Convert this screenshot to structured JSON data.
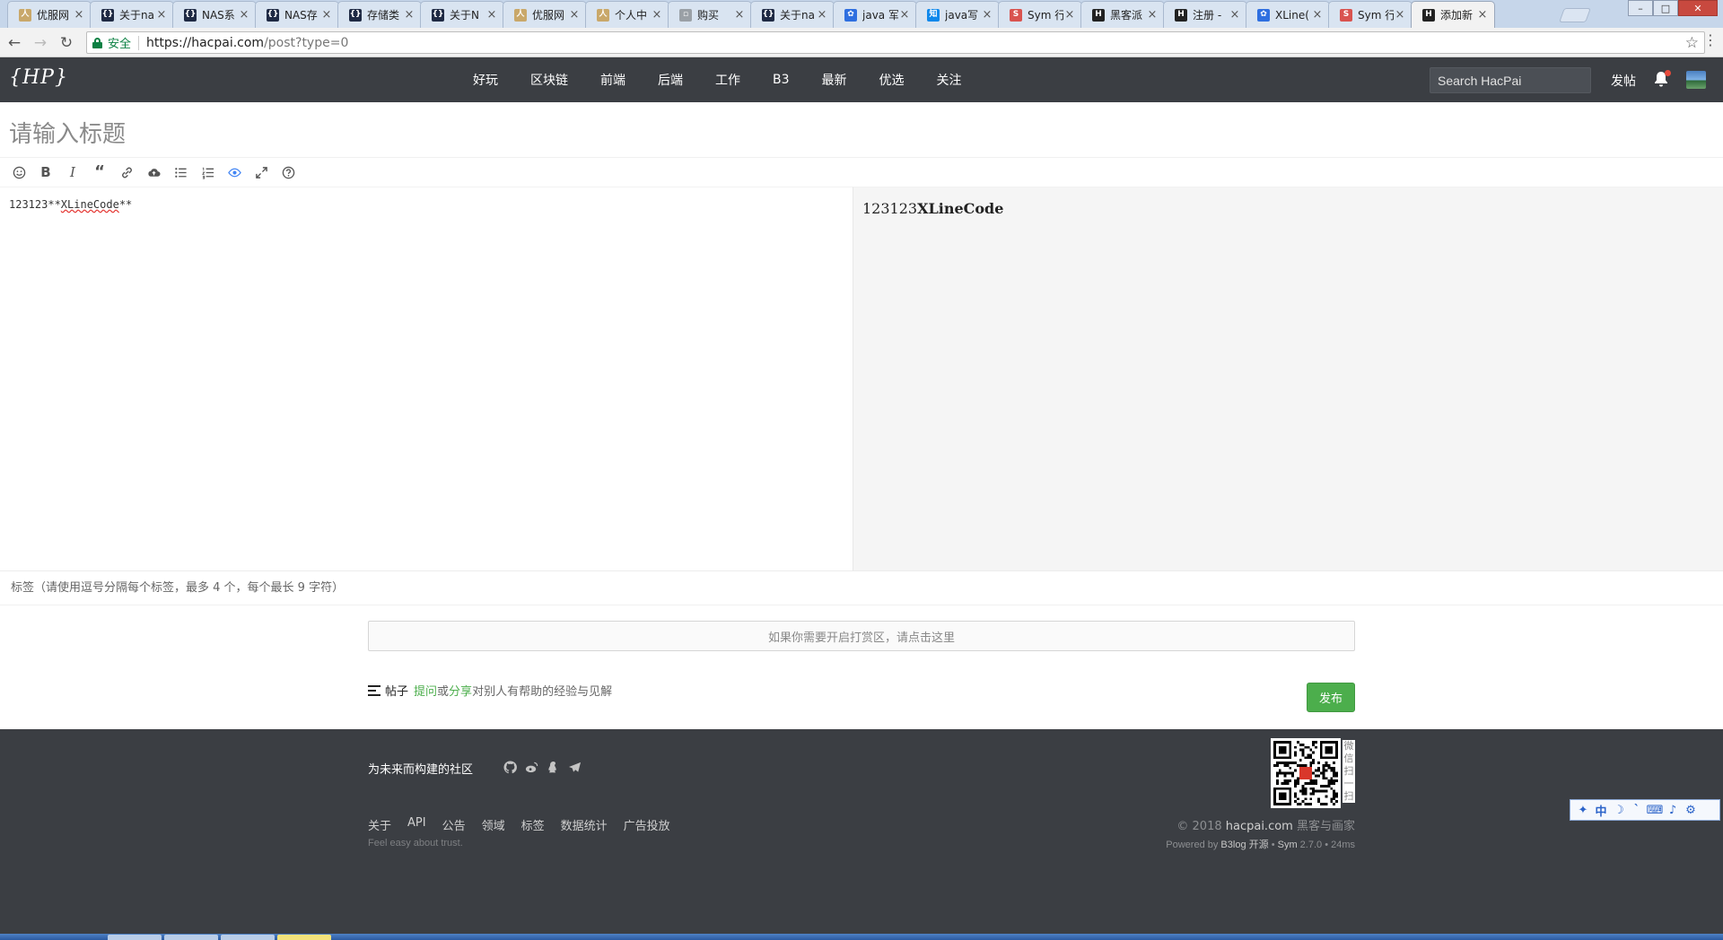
{
  "browser": {
    "tabs": [
      {
        "title": "优服网",
        "fav": "user",
        "color": "#c9a86a",
        "mark": "人",
        "active": false
      },
      {
        "title": "关于na",
        "fav": "code",
        "color": "#1f2a44",
        "mark": "{}",
        "active": false
      },
      {
        "title": "NAS系",
        "fav": "code",
        "color": "#1f2a44",
        "mark": "{}",
        "active": false
      },
      {
        "title": "NAS存",
        "fav": "code",
        "color": "#1f2a44",
        "mark": "{}",
        "active": false
      },
      {
        "title": "存储类",
        "fav": "code",
        "color": "#1f2a44",
        "mark": "{}",
        "active": false
      },
      {
        "title": "关于N",
        "fav": "code",
        "color": "#1f2a44",
        "mark": "{}",
        "active": false
      },
      {
        "title": "优服网",
        "fav": "user",
        "color": "#c9a86a",
        "mark": "人",
        "active": false
      },
      {
        "title": "个人中",
        "fav": "user",
        "color": "#c9a86a",
        "mark": "人",
        "active": false
      },
      {
        "title": "购买",
        "fav": "doc",
        "color": "#9aa0a6",
        "mark": "▫",
        "active": false
      },
      {
        "title": "关于na",
        "fav": "code",
        "color": "#1f2a44",
        "mark": "{}",
        "active": false
      },
      {
        "title": "java 军",
        "fav": "paw",
        "color": "#2f6fe0",
        "mark": "✿",
        "active": false
      },
      {
        "title": "java写",
        "fav": "zhihu",
        "color": "#0f88eb",
        "mark": "知",
        "active": false
      },
      {
        "title": "Sym 行",
        "fav": "sym",
        "color": "#d9534f",
        "mark": "S",
        "active": false
      },
      {
        "title": "黑客派",
        "fav": "hp",
        "color": "#222222",
        "mark": "H",
        "active": false
      },
      {
        "title": "注册 -",
        "fav": "hp",
        "color": "#222222",
        "mark": "H",
        "active": false
      },
      {
        "title": "XLine(",
        "fav": "paw",
        "color": "#2f6fe0",
        "mark": "✿",
        "active": false
      },
      {
        "title": "Sym 行",
        "fav": "sym",
        "color": "#d9534f",
        "mark": "S",
        "active": false
      },
      {
        "title": "添加新",
        "fav": "hp",
        "color": "#222222",
        "mark": "H",
        "active": true
      }
    ],
    "tab_close_glyph": "×",
    "secure_label": "安全",
    "url_host": "https://hacpai.com",
    "url_path": "/post?type=0"
  },
  "site": {
    "logo": "{HP}",
    "nav": [
      "好玩",
      "区块链",
      "前端",
      "后端",
      "工作",
      "B3",
      "最新",
      "优选",
      "关注"
    ],
    "search_placeholder": "Search HacPai",
    "post_link": "发帖"
  },
  "editor": {
    "title_placeholder": "请输入标题",
    "toolbar": [
      "emoji-icon",
      "bold-icon",
      "italic-icon",
      "quote-icon",
      "link-icon",
      "upload-icon",
      "unordered-list-icon",
      "ordered-list-icon",
      "preview-icon",
      "fullscreen-icon",
      "help-icon"
    ],
    "content_prefix": "123123**",
    "content_word": "XLineCode",
    "content_suffix": "**",
    "preview_plain": "123123",
    "preview_bold": "XLineCode"
  },
  "tags_placeholder": "标签（请使用逗号分隔每个标签，最多 4 个，每个最长 9 字符）",
  "reward_prompt": "如果你需要开启打赏区，请点击这里",
  "post_type": {
    "label": "帖子",
    "ask": "提问",
    "or": "或",
    "share": "分享",
    "rest": "对别人有帮助的经验与见解"
  },
  "publish_label": "发布",
  "footer": {
    "slogan": "为未来而构建的社区",
    "social": [
      "github-icon",
      "weibo-icon",
      "qq-icon",
      "telegram-icon"
    ],
    "links": [
      "关于",
      "API",
      "公告",
      "领域",
      "标签",
      "数据统计",
      "广告投放"
    ],
    "tagline": "Feel easy about trust.",
    "qr_label": [
      "微",
      "信",
      "扫",
      "一",
      "扫"
    ],
    "copyright_prefix": "© 2018",
    "copyright_host": "hacpai.com",
    "copyright_suffix": "黑客与画家",
    "powered_prefix": "Powered by",
    "powered_b3log": "B3log 开源",
    "powered_dot": "•",
    "powered_sym": "Sym",
    "powered_version": "2.7.0 • 24ms"
  },
  "ime": [
    "✦",
    "中",
    "☽",
    "ˋ",
    "⌨",
    "♪",
    "⚙"
  ]
}
